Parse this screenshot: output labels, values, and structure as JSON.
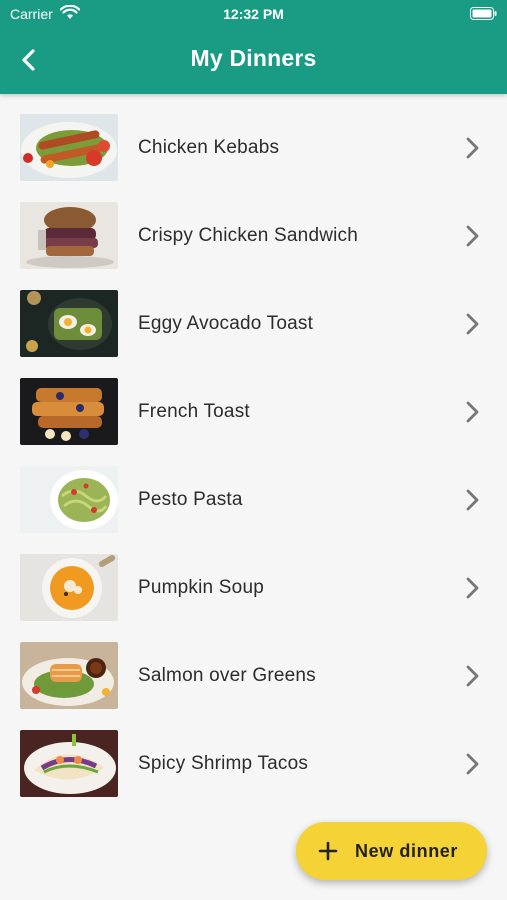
{
  "status_bar": {
    "carrier": "Carrier",
    "time": "12:32 PM"
  },
  "app_bar": {
    "title": "My Dinners",
    "back_icon": "chevron-left-icon"
  },
  "dinners": [
    {
      "name": "Chicken Kebabs"
    },
    {
      "name": "Crispy Chicken Sandwich"
    },
    {
      "name": "Eggy Avocado Toast"
    },
    {
      "name": "French Toast"
    },
    {
      "name": "Pesto Pasta"
    },
    {
      "name": "Pumpkin Soup"
    },
    {
      "name": "Salmon over Greens"
    },
    {
      "name": "Spicy Shrimp Tacos"
    }
  ],
  "fab": {
    "label": "New dinner",
    "icon": "plus-icon"
  },
  "colors": {
    "header": "#1a9c84",
    "fab": "#f5d235",
    "background": "#f6f6f6",
    "chevron": "#777777"
  }
}
